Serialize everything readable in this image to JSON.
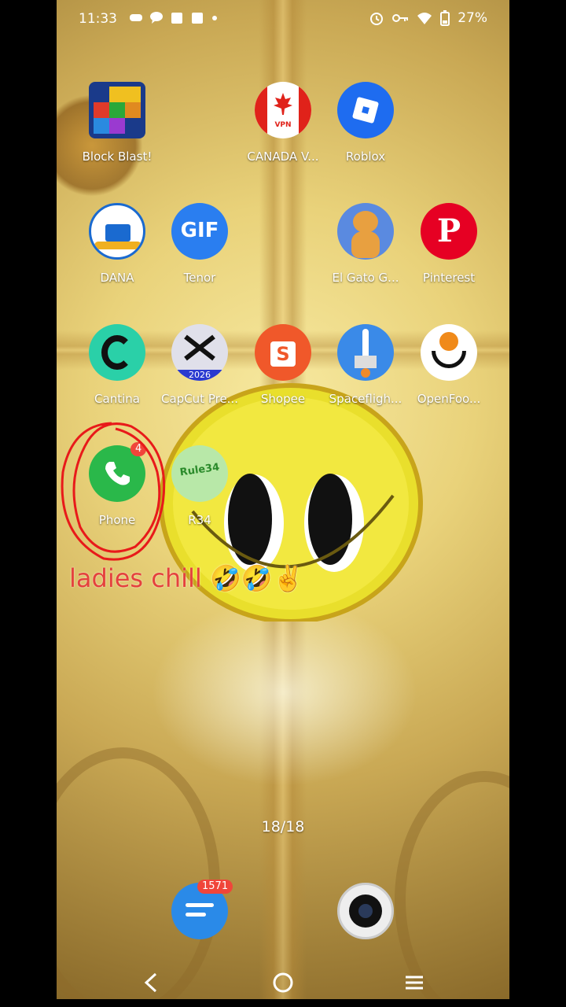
{
  "status_bar": {
    "time": "11:33",
    "battery": "27%",
    "left_icons": [
      "game-controller-icon",
      "chat-bubble-icon",
      "bag-icon",
      "bag-icon",
      "dot-icon"
    ],
    "right_icons": [
      "alarm-icon",
      "key-icon",
      "wifi-icon",
      "battery-icon"
    ]
  },
  "apps": [
    {
      "label": "Block Blast!",
      "icon": "block-blast-icon"
    },
    {
      "label": "CANADA V...",
      "icon": "canada-vpn-icon",
      "icon_text": "VPN"
    },
    {
      "label": "Roblox",
      "icon": "roblox-icon"
    },
    {
      "label": "DANA",
      "icon": "dana-icon"
    },
    {
      "label": "Tenor",
      "icon": "tenor-icon",
      "icon_text": "GIF"
    },
    {
      "label": "El Gato G...",
      "icon": "el-gato-icon"
    },
    {
      "label": "Pinterest",
      "icon": "pinterest-icon",
      "icon_text": "P"
    },
    {
      "label": "Cantina",
      "icon": "cantina-icon"
    },
    {
      "label": "CapCut Pre...",
      "icon": "capcut-icon",
      "icon_text": "2026"
    },
    {
      "label": "Shopee",
      "icon": "shopee-icon",
      "icon_text": "S"
    },
    {
      "label": "Spacefligh...",
      "icon": "spaceflight-icon"
    },
    {
      "label": "OpenFoo...",
      "icon": "openfood-icon"
    },
    {
      "label": "Phone",
      "icon": "phone-icon",
      "badge": "4"
    },
    {
      "label": "R34",
      "icon": "r34-icon",
      "icon_text": "Rule34"
    }
  ],
  "caption": "ladies chill 🤣🤣✌️",
  "pager": "18/18",
  "dock": [
    {
      "icon": "messages-icon",
      "badge": "1571"
    },
    {
      "icon": "camera-icon"
    }
  ],
  "colors": {
    "badge": "#f0453a",
    "caption": "#e5413d",
    "annotation_circle": "#e81a1a"
  }
}
